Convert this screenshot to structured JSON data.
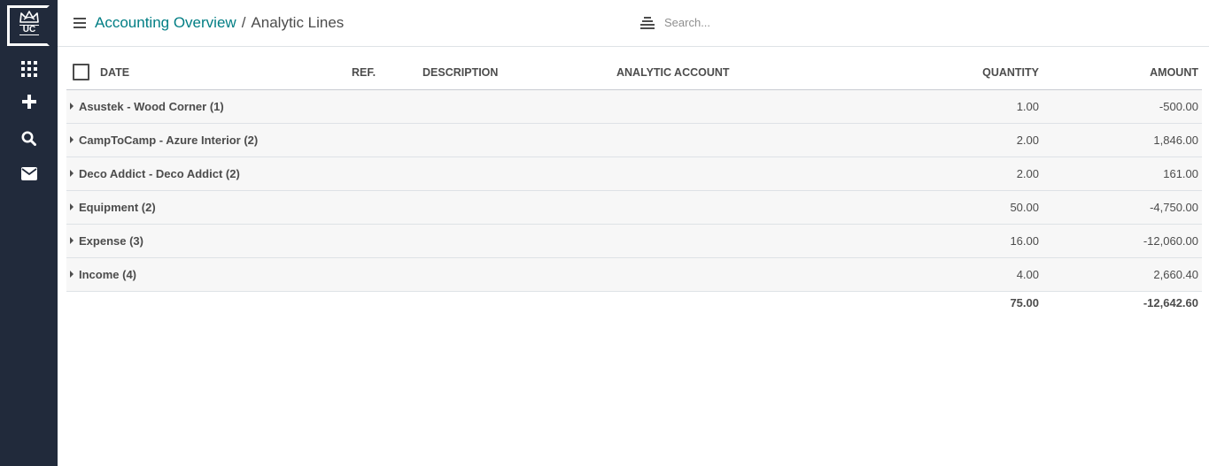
{
  "sidebar": {
    "logo_text": "UC",
    "buttons": [
      {
        "name": "apps-menu-icon"
      },
      {
        "name": "plus-icon"
      },
      {
        "name": "search-icon"
      },
      {
        "name": "envelope-icon"
      }
    ]
  },
  "header": {
    "breadcrumb_parent": "Accounting Overview",
    "breadcrumb_separator": "/",
    "breadcrumb_current": "Analytic Lines",
    "search_placeholder": "Search..."
  },
  "table": {
    "columns": {
      "date": "DATE",
      "ref": "REF.",
      "description": "DESCRIPTION",
      "analytic_account": "ANALYTIC ACCOUNT",
      "quantity": "QUANTITY",
      "amount": "AMOUNT"
    },
    "groups": [
      {
        "label": "Asustek - Wood Corner (1)",
        "quantity": "1.00",
        "amount": "-500.00"
      },
      {
        "label": "CampToCamp - Azure Interior (2)",
        "quantity": "2.00",
        "amount": "1,846.00"
      },
      {
        "label": "Deco Addict - Deco Addict (2)",
        "quantity": "2.00",
        "amount": "161.00"
      },
      {
        "label": "Equipment (2)",
        "quantity": "50.00",
        "amount": "-4,750.00"
      },
      {
        "label": "Expense (3)",
        "quantity": "16.00",
        "amount": "-12,060.00"
      },
      {
        "label": "Income (4)",
        "quantity": "4.00",
        "amount": "2,660.40"
      }
    ],
    "totals": {
      "quantity": "75.00",
      "amount": "-12,642.60"
    }
  }
}
